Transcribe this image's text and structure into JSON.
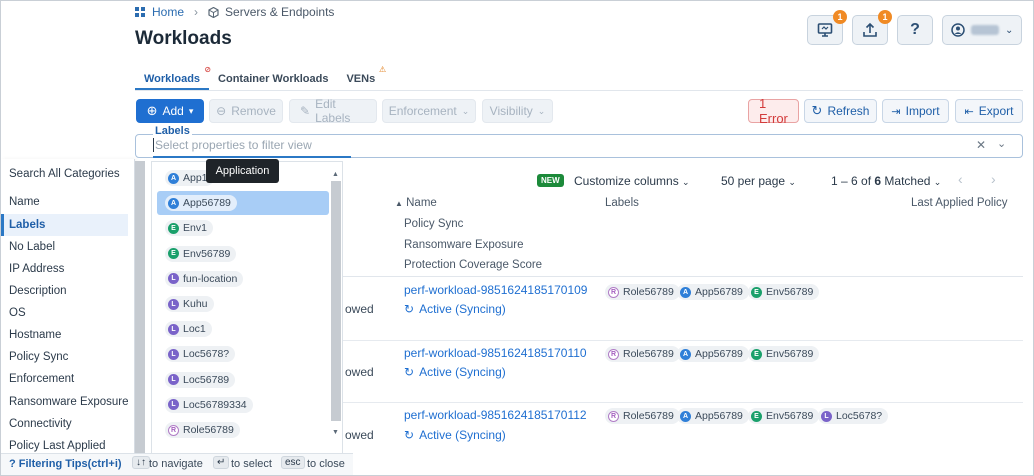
{
  "breadcrumb": {
    "home": "Home",
    "current": "Servers & Endpoints"
  },
  "page_title": "Workloads",
  "header_buttons": {
    "notification_badge": "1",
    "upload_badge": "1",
    "help": "?"
  },
  "tabs": [
    {
      "label": "Workloads"
    },
    {
      "label": "Container Workloads"
    },
    {
      "label": "VENs"
    }
  ],
  "toolbar": {
    "add": "Add",
    "remove": "Remove",
    "edit_labels": "Edit Labels",
    "enforcement": "Enforcement",
    "visibility": "Visibility",
    "error": "1 Error",
    "refresh": "Refresh",
    "import": "Import",
    "export": "Export"
  },
  "filter": {
    "label": "Labels",
    "placeholder": "Select properties to filter view"
  },
  "tooltip": "Application",
  "table_controls": {
    "new_badge": "NEW",
    "customize": "Customize columns",
    "per_page": "50 per page",
    "matched_prefix": "1 – 6 of",
    "matched_count": "6",
    "matched_suffix": "Matched"
  },
  "columns": {
    "name": "Name",
    "policy_sync": "Policy Sync",
    "ransomware": "Ransomware Exposure",
    "protection": "Protection Coverage Score",
    "labels": "Labels",
    "last_applied": "Last Applied Policy"
  },
  "rows": [
    {
      "truncated": "owed",
      "name": "perf-workload-9851624185170109",
      "status": "Active (Syncing)",
      "labels": [
        "Role56789",
        "App56789",
        "Env56789"
      ]
    },
    {
      "truncated": "owed",
      "name": "perf-workload-9851624185170110",
      "status": "Active (Syncing)",
      "labels": [
        "Role56789",
        "App56789",
        "Env56789"
      ]
    },
    {
      "truncated": "owed",
      "name": "perf-workload-9851624185170112",
      "status": "Active (Syncing)",
      "labels": [
        "Role56789",
        "App56789",
        "Env56789",
        "Loc5678?"
      ]
    }
  ],
  "categories": [
    "Search All Categories",
    "Name",
    "Labels",
    "No Label",
    "IP Address",
    "Description",
    "OS",
    "Hostname",
    "Policy Sync",
    "Enforcement",
    "Ransomware Exposure",
    "Connectivity",
    "Policy Last Applied"
  ],
  "values": [
    {
      "label": "App1",
      "type": "app"
    },
    {
      "label": "App56789",
      "type": "app"
    },
    {
      "label": "Env1",
      "type": "env"
    },
    {
      "label": "Env56789",
      "type": "env"
    },
    {
      "label": "fun-location",
      "type": "loc"
    },
    {
      "label": "Kuhu",
      "type": "loc"
    },
    {
      "label": "Loc1",
      "type": "loc"
    },
    {
      "label": "Loc5678?",
      "type": "loc"
    },
    {
      "label": "Loc56789",
      "type": "loc"
    },
    {
      "label": "Loc56789334",
      "type": "loc"
    },
    {
      "label": "Role56789",
      "type": "role"
    }
  ],
  "hints": {
    "tips": "? Filtering Tips(ctrl+i)",
    "navigate_key": "↓↑",
    "navigate": "to navigate",
    "select_key": "↵",
    "select": "to select",
    "close_key": "esc",
    "close": "to close"
  }
}
